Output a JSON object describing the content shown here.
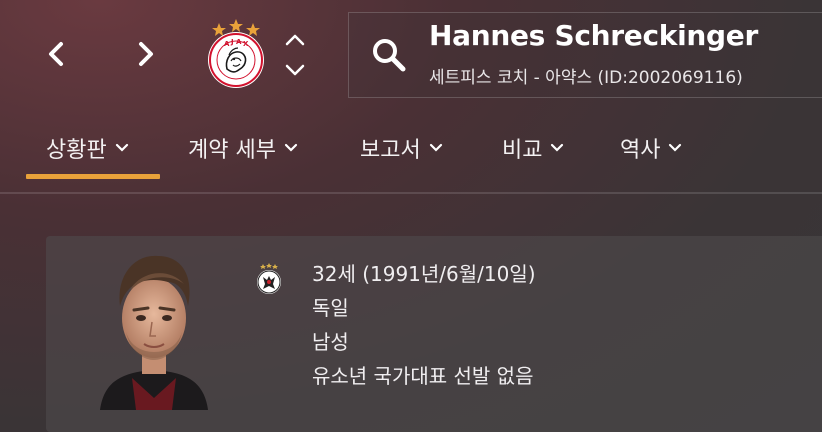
{
  "header": {
    "player_name": "Hannes Schreckinger",
    "player_subtitle": "세트피스 코치 - 아약스 (ID:2002069116)",
    "club_logo": "ajax-crest",
    "club_logo_text": "AJAX AMSTERDAM"
  },
  "tabs": [
    {
      "label": "상황판",
      "active": true
    },
    {
      "label": "계약 세부",
      "active": false
    },
    {
      "label": "보고서",
      "active": false
    },
    {
      "label": "비교",
      "active": false
    },
    {
      "label": "역사",
      "active": false
    }
  ],
  "profile": {
    "age_line": "32세 (1991년/6월/10일)",
    "nationality": "독일",
    "gender": "남성",
    "youth_caps": "유소년 국가대표 선발 없음",
    "nation_badge": "germany-crest"
  },
  "colors": {
    "tab_underline": "#e9a23a",
    "ajax_red": "#d2122e",
    "star_gold": "#e9a23a"
  }
}
